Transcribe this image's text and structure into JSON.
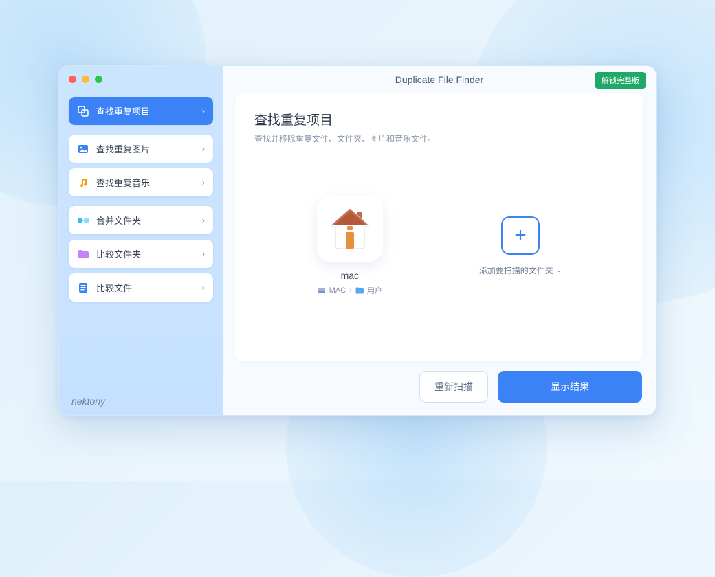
{
  "app_title": "Duplicate File Finder",
  "unlock_label": "解锁完整版",
  "brand": "nektony",
  "sidebar": {
    "items": [
      {
        "label": "查找重复项目",
        "icon": "duplicate-items-icon",
        "active": true
      },
      {
        "label": "查找重复图片",
        "icon": "image-icon",
        "active": false
      },
      {
        "label": "查找重复音乐",
        "icon": "music-icon",
        "active": false
      },
      {
        "label": "合并文件夹",
        "icon": "merge-icon",
        "active": false
      },
      {
        "label": "比较文件夹",
        "icon": "folder-icon",
        "active": false
      },
      {
        "label": "比较文件",
        "icon": "file-icon",
        "active": false
      }
    ]
  },
  "main": {
    "title": "查找重复项目",
    "subtitle": "查找并移除重复文件、文件夹、图片和音乐文件。",
    "folder": {
      "name": "mac",
      "crumb_volume": "MAC",
      "crumb_dir": "用户"
    },
    "add_folder_label": "添加要扫描的文件夹"
  },
  "footer": {
    "rescan": "重新扫描",
    "show_results": "显示结果"
  }
}
